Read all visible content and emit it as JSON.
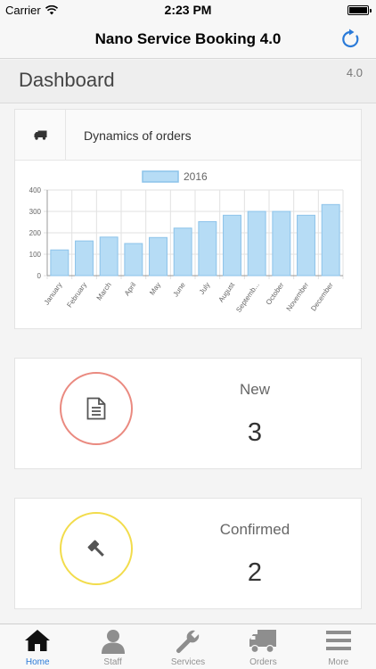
{
  "status_bar": {
    "carrier": "Carrier",
    "time": "2:23 PM"
  },
  "nav": {
    "title": "Nano Service Booking 4.0",
    "refresh_icon": "refresh-icon"
  },
  "header": {
    "title": "Dashboard",
    "version": "4.0"
  },
  "orders_chart": {
    "title": "Dynamics of orders",
    "icon": "truck-icon"
  },
  "chart_data": {
    "type": "bar",
    "title": "",
    "xlabel": "",
    "ylabel": "",
    "categories": [
      "January",
      "February",
      "March",
      "April",
      "May",
      "June",
      "July",
      "August",
      "September",
      "October",
      "November",
      "December"
    ],
    "tick_labels": [
      "January",
      "February",
      "March",
      "April",
      "May",
      "June",
      "July",
      "August",
      "Septemb...",
      "October",
      "November",
      "December"
    ],
    "series": [
      {
        "name": "2016",
        "values": [
          120,
          162,
          180,
          150,
          178,
          222,
          252,
          282,
          300,
          300,
          282,
          332
        ]
      }
    ],
    "ylim": [
      0,
      400
    ],
    "yticks": [
      0,
      100,
      200,
      300,
      400
    ],
    "grid": true,
    "legend": "top-center",
    "colors": {
      "bar_fill": "#b6dcf5",
      "bar_stroke": "#8cc3ea"
    }
  },
  "stats": {
    "new": {
      "label": "New",
      "value": "3",
      "icon": "document-icon",
      "color": "#ea8a80"
    },
    "confirmed": {
      "label": "Confirmed",
      "value": "2",
      "icon": "gavel-icon",
      "color": "#f2dc4c"
    }
  },
  "tabs": [
    {
      "label": "Home",
      "icon": "home-icon",
      "active": true
    },
    {
      "label": "Staff",
      "icon": "person-icon",
      "active": false
    },
    {
      "label": "Services",
      "icon": "wrench-icon",
      "active": false
    },
    {
      "label": "Orders",
      "icon": "truck-icon",
      "active": false
    },
    {
      "label": "More",
      "icon": "menu-icon",
      "active": false
    }
  ],
  "colors": {
    "accent": "#2a7ad8"
  }
}
